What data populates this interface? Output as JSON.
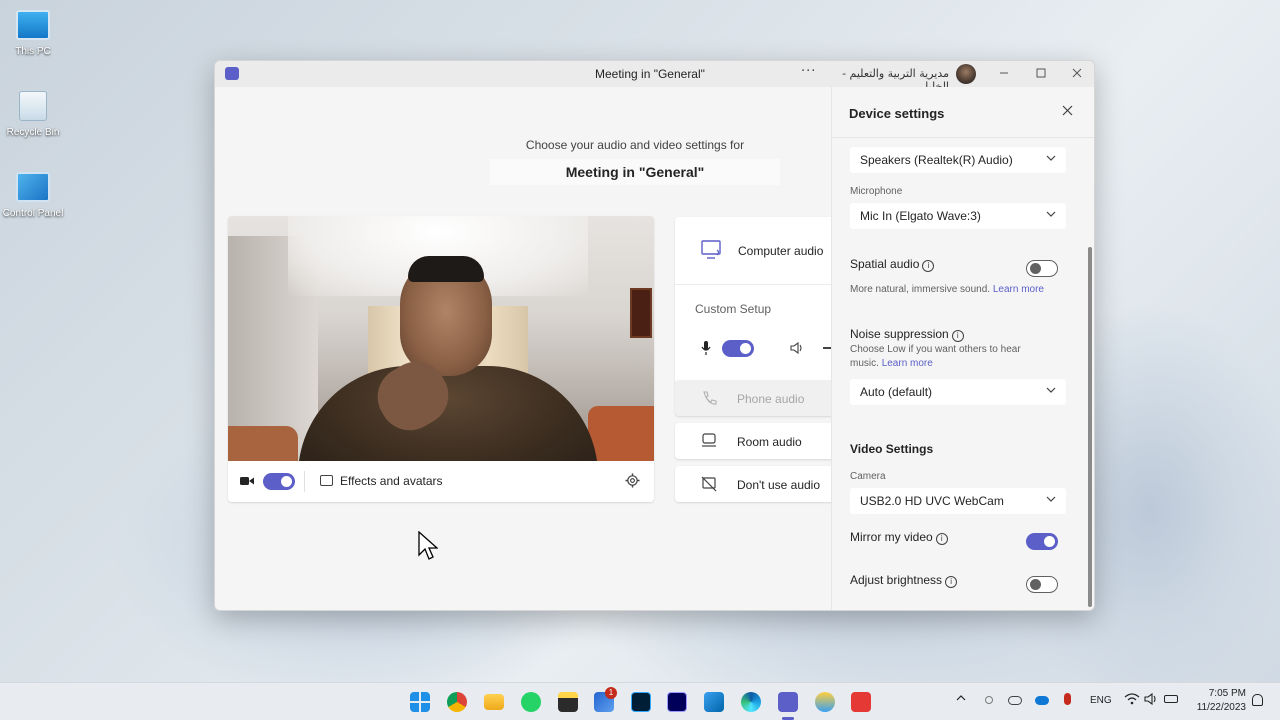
{
  "desktop": {
    "icons": [
      {
        "label": "This PC"
      },
      {
        "label": "Recycle Bin"
      },
      {
        "label": "Control Panel"
      }
    ]
  },
  "window": {
    "title": "Meeting in \"General\"",
    "org_name": "مديرية التربية والتعليم - الخليل",
    "more_label": "···"
  },
  "prejoin": {
    "choose_text": "Choose your audio and video settings for",
    "meeting_title": "Meeting in \"General\"",
    "camera_on": true,
    "effects_label": "Effects and avatars"
  },
  "audio_options": {
    "computer_audio": "Computer audio",
    "custom_setup": "Custom Setup",
    "mic_on": true,
    "phone_audio": "Phone audio",
    "room_audio": "Room audio",
    "no_audio": "Don't use audio"
  },
  "device_settings": {
    "title": "Device settings",
    "speaker": "Speakers (Realtek(R) Audio)",
    "microphone_label": "Microphone",
    "microphone": "Mic In (Elgato Wave:3)",
    "spatial_audio": {
      "label": "Spatial audio",
      "on": false,
      "help": "More natural, immersive sound.",
      "link": "Learn more"
    },
    "noise_suppression": {
      "label": "Noise suppression",
      "help": "Choose Low if you want others to hear music.",
      "link": "Learn more",
      "value": "Auto (default)"
    },
    "video_settings_title": "Video Settings",
    "camera_label": "Camera",
    "camera": "USB2.0 HD UVC WebCam",
    "mirror_video": {
      "label": "Mirror my video",
      "on": true
    },
    "adjust_brightness": {
      "label": "Adjust brightness",
      "on": false
    }
  },
  "taskbar": {
    "language": "ENG",
    "time": "7:05 PM",
    "date": "11/22/2023",
    "badge_count": "1"
  },
  "colors": {
    "accent": "#5b5fc7",
    "window_bg": "#f5f5f5",
    "card_bg": "#ffffff"
  }
}
